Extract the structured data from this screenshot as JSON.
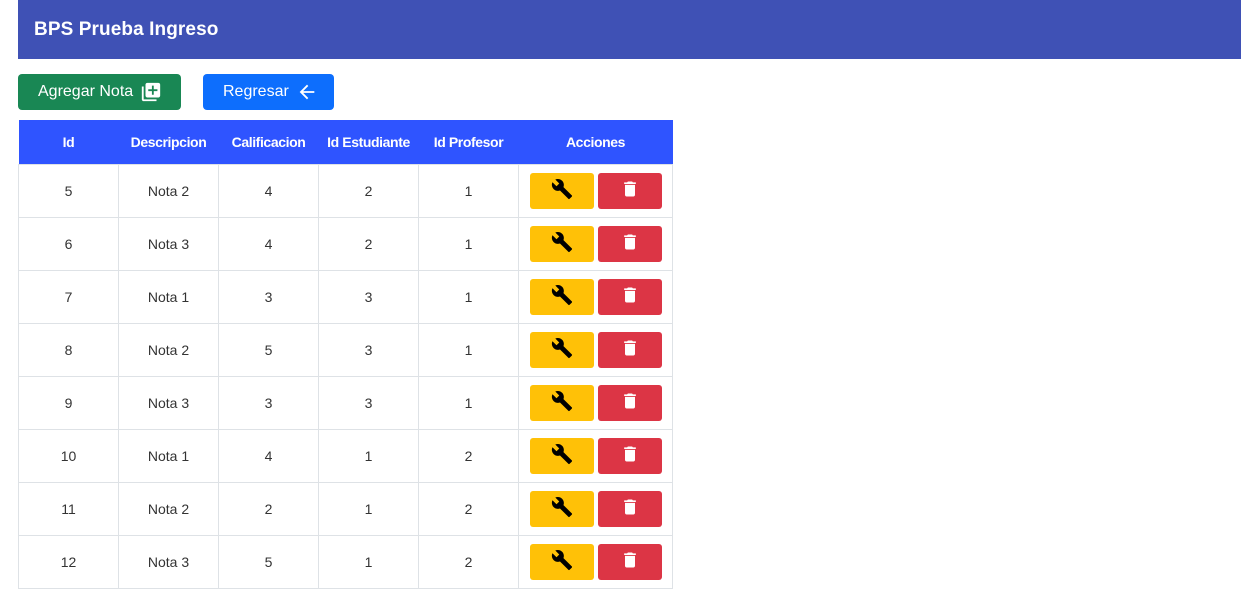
{
  "app": {
    "title": "BPS Prueba Ingreso"
  },
  "toolbar": {
    "add_label": "Agregar Nota",
    "add_icon": "add-box-icon",
    "back_label": "Regresar",
    "back_icon": "arrow-left-icon"
  },
  "colors": {
    "appbar": "#3f51b5",
    "add_button": "#198754",
    "back_button": "#0d6efd",
    "table_header": "#2f54ff",
    "edit_button": "#ffc107",
    "delete_button": "#dc3545"
  },
  "table": {
    "columns": [
      "Id",
      "Descripcion",
      "Calificacion",
      "Id Estudiante",
      "Id Profesor",
      "Acciones"
    ],
    "action_icons": {
      "edit": "wrench-icon",
      "delete": "trash-icon"
    },
    "rows": [
      {
        "id": "5",
        "descripcion": "Nota 2",
        "calificacion": "4",
        "id_estudiante": "2",
        "id_profesor": "1"
      },
      {
        "id": "6",
        "descripcion": "Nota 3",
        "calificacion": "4",
        "id_estudiante": "2",
        "id_profesor": "1"
      },
      {
        "id": "7",
        "descripcion": "Nota 1",
        "calificacion": "3",
        "id_estudiante": "3",
        "id_profesor": "1"
      },
      {
        "id": "8",
        "descripcion": "Nota 2",
        "calificacion": "5",
        "id_estudiante": "3",
        "id_profesor": "1"
      },
      {
        "id": "9",
        "descripcion": "Nota 3",
        "calificacion": "3",
        "id_estudiante": "3",
        "id_profesor": "1"
      },
      {
        "id": "10",
        "descripcion": "Nota 1",
        "calificacion": "4",
        "id_estudiante": "1",
        "id_profesor": "2"
      },
      {
        "id": "11",
        "descripcion": "Nota 2",
        "calificacion": "2",
        "id_estudiante": "1",
        "id_profesor": "2"
      },
      {
        "id": "12",
        "descripcion": "Nota 3",
        "calificacion": "5",
        "id_estudiante": "1",
        "id_profesor": "2"
      }
    ]
  }
}
